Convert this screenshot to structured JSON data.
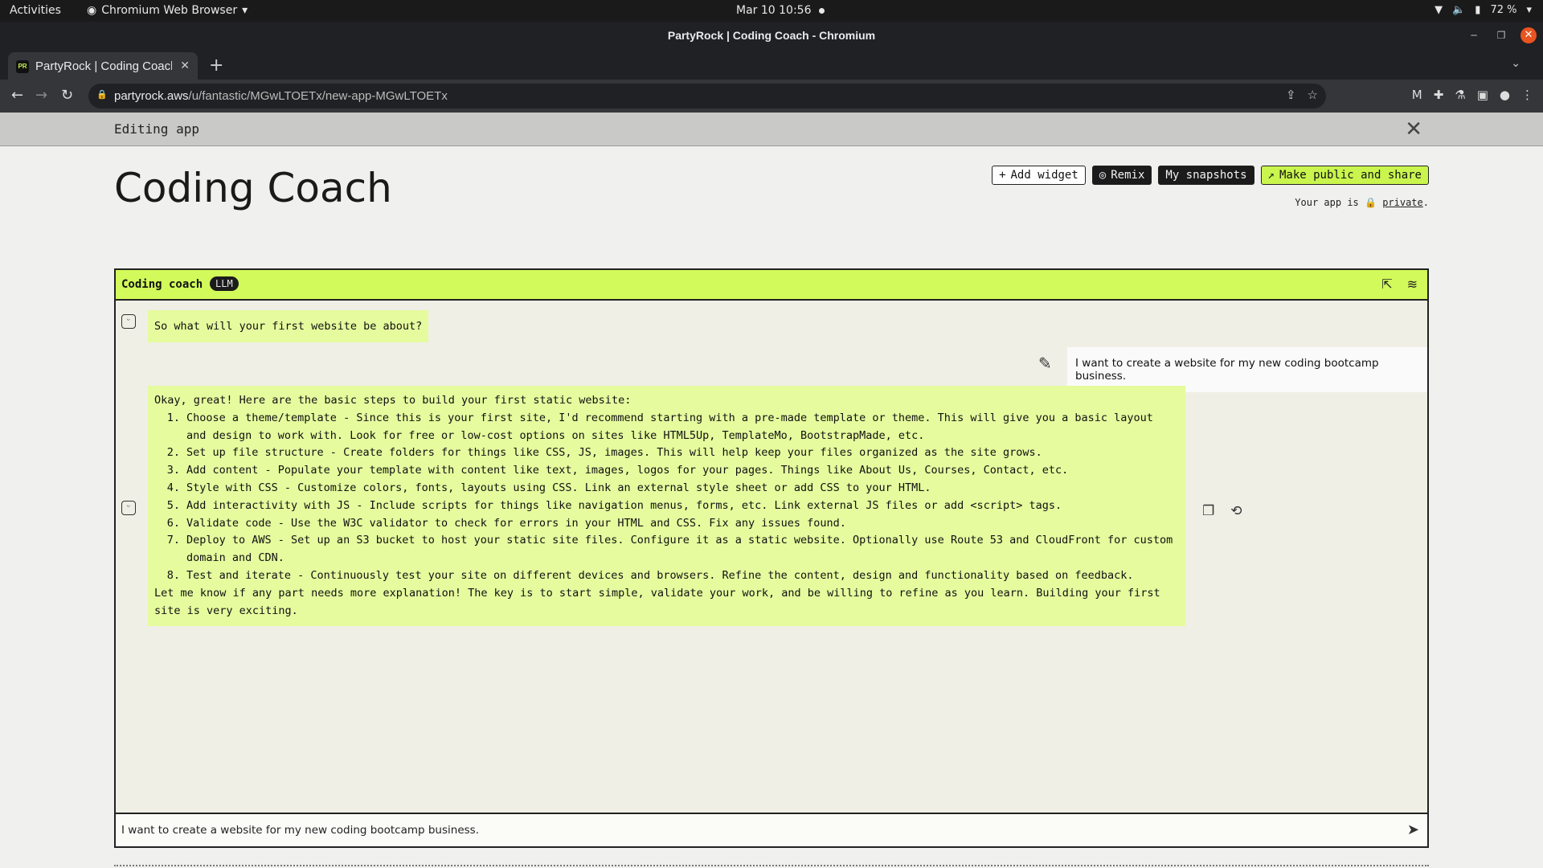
{
  "system_bar": {
    "activities": "Activities",
    "app_name": "Chromium Web Browser",
    "clock": "Mar 10  10:56",
    "battery": "72 %"
  },
  "window": {
    "title": "PartyRock | Coding Coach - Chromium"
  },
  "tab": {
    "favicon_text": "PR",
    "title": "PartyRock | Coding Coach"
  },
  "address_bar": {
    "host": "partyrock.aws",
    "path": "/u/fantastic/MGwLTOETx/new-app-MGwLTOETx"
  },
  "banner": {
    "label": "Editing app"
  },
  "app": {
    "title": "Coding Coach",
    "actions": {
      "add_widget": "Add widget",
      "remix": "Remix",
      "snapshots": "My snapshots",
      "share": "Make public and share"
    },
    "privacy": {
      "prefix": "Your app is",
      "status": "private",
      "suffix": "."
    }
  },
  "widget": {
    "title": "Coding coach",
    "badge": "LLM",
    "messages": {
      "assistant_1": "So what will your first website be about?",
      "user_1": "I want to create a website for my new coding bootcamp business.",
      "assistant_2": {
        "intro": "Okay, great! Here are the basic steps to build your first static website:",
        "steps": [
          {
            "num": "1.",
            "text": "Choose a theme/template - Since this is your first site, I'd recommend starting with a pre-made template or theme. This will give you a basic layout and design to work with. Look for free or low-cost options on sites like HTML5Up, TemplateMo, BootstrapMade, etc."
          },
          {
            "num": "2.",
            "text": "Set up file structure - Create folders for things like CSS, JS, images. This will help keep your files organized as the site grows."
          },
          {
            "num": "3.",
            "text": "Add content - Populate your template with content like text, images, logos for your pages. Things like About Us, Courses, Contact, etc."
          },
          {
            "num": "4.",
            "text": "Style with CSS - Customize colors, fonts, layouts using CSS. Link an external style sheet or add CSS to your HTML."
          },
          {
            "num": "5.",
            "text": "Add interactivity with JS - Include scripts for things like navigation menus, forms, etc. Link external JS files or add <script> tags."
          },
          {
            "num": "6.",
            "text": "Validate code - Use the W3C validator to check for errors in your HTML and CSS. Fix any issues found."
          },
          {
            "num": "7.",
            "text": "Deploy to AWS - Set up an S3 bucket to host your static site files. Configure it as a static website. Optionally use Route 53 and CloudFront for custom domain and CDN."
          },
          {
            "num": "8.",
            "text": "Test and iterate - Continuously test your site on different devices and browsers. Refine the content, design and functionality based on feedback."
          }
        ],
        "outro": "Let me know if any part needs more explanation! The key is to start simple, validate your work, and be willing to refine as you learn. Building your first site is very exciting."
      }
    },
    "input": {
      "value": "I want to create a website for my new coding bootcamp business."
    }
  },
  "colors": {
    "accent_lime": "#d2fa5a",
    "bubble_lime": "#e5fb9e",
    "dark": "#1b1b1b"
  }
}
